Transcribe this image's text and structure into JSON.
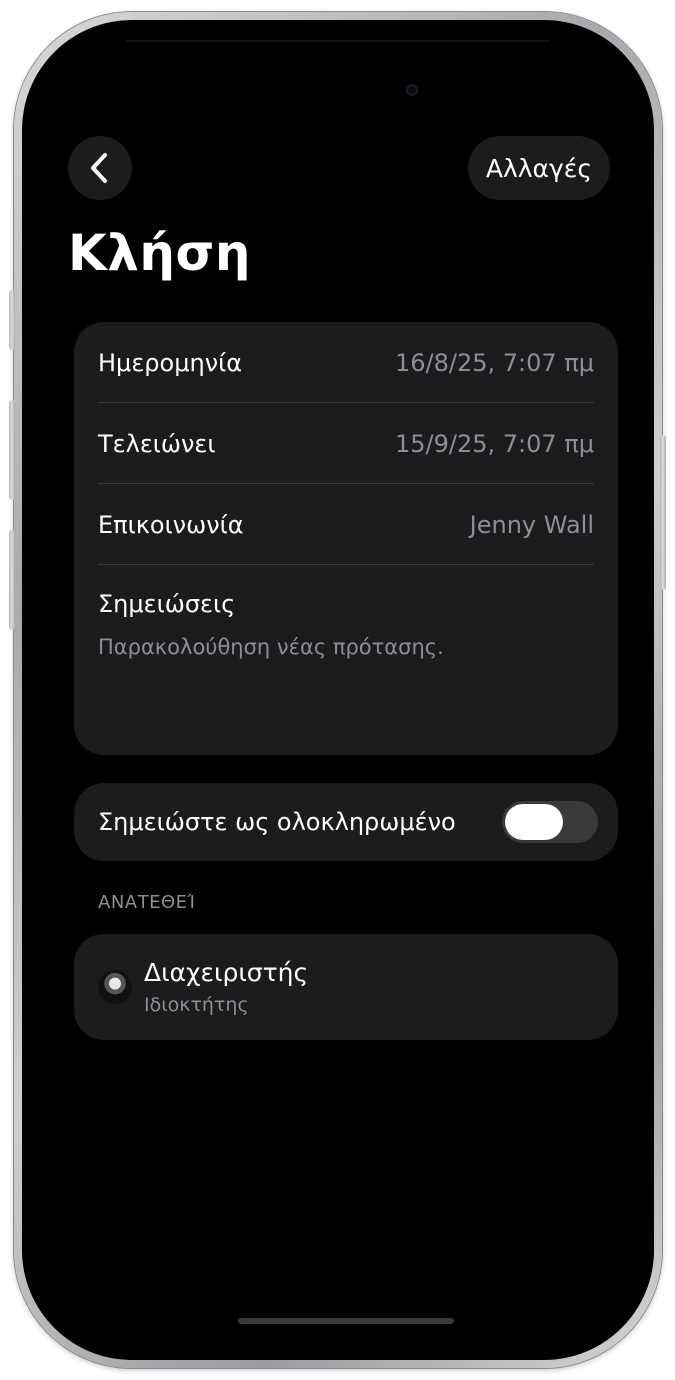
{
  "nav": {
    "back_icon": "chevron-left-icon",
    "edit_label": "Αλλαγές"
  },
  "page": {
    "title": "Κλήση"
  },
  "details": {
    "date_label": "Ημερομηνία",
    "date_value": "16/8/25, 7:07 πμ",
    "ends_label": "Τελειώνει",
    "ends_value": "15/9/25, 7:07 πμ",
    "contact_label": "Επικοινωνία",
    "contact_value": "Jenny Wall",
    "notes_label": "Σημειώσεις",
    "notes_value": "Παρακολούθηση νέας πρότασης."
  },
  "completion": {
    "label": "Σημειώστε ως ολοκληρωμένο",
    "toggled": false
  },
  "assigned": {
    "header": "ΑΝΑΤΕΘΕΊ",
    "name": "Διαχειριστής",
    "role": "Ιδιοκτήτης"
  },
  "colors": {
    "background": "#000000",
    "card": "#1c1c1e",
    "secondary_text": "#8e8e93",
    "separator": "#38383a"
  }
}
